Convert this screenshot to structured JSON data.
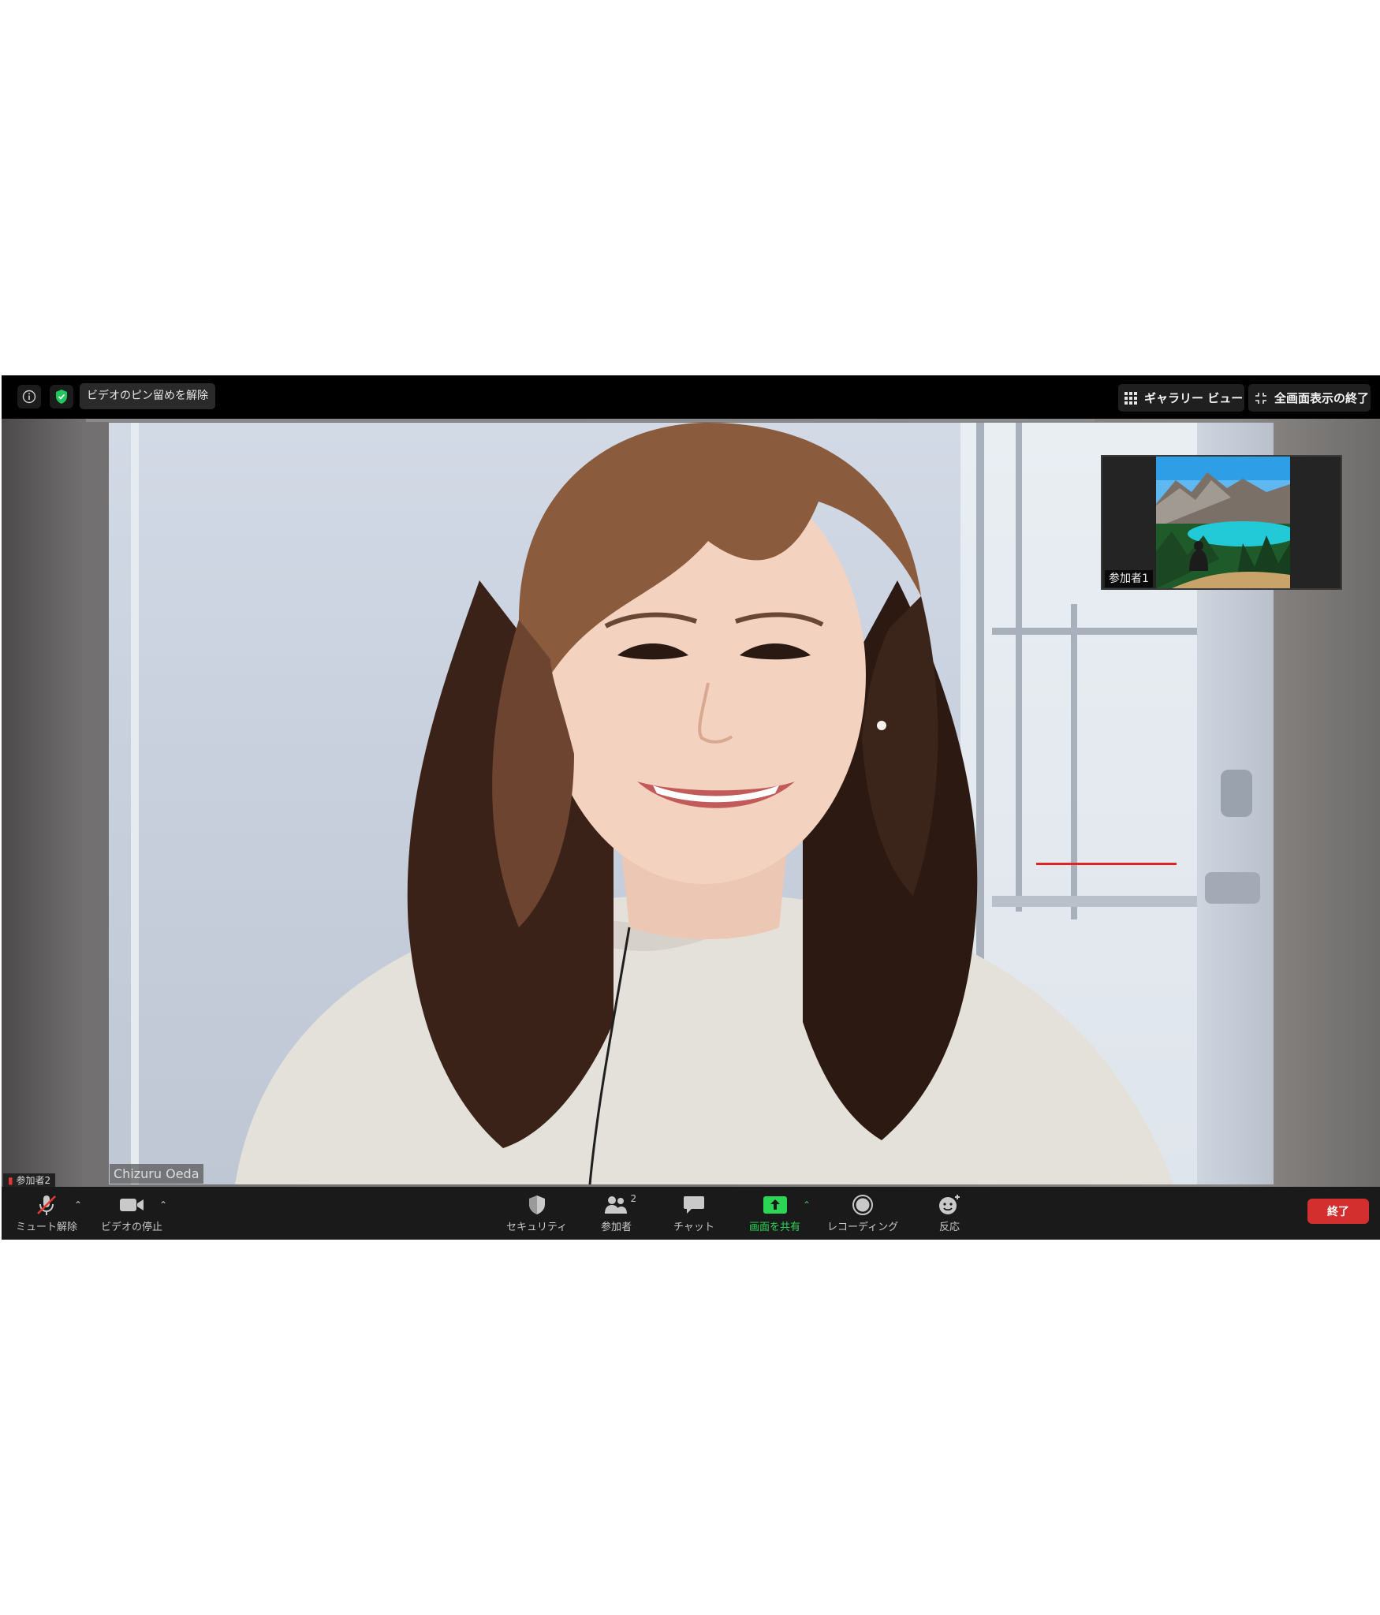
{
  "topbar": {
    "unpin_label": "ビデオのピン留めを解除",
    "gallery_label": "ギャラリー ビュー",
    "exit_fullscreen_label": "全画面表示の終了"
  },
  "main_video": {
    "name": "Chizuru Oeda"
  },
  "thumbnail": {
    "name": "参加者1"
  },
  "participant2": {
    "name": "参加者2"
  },
  "toolbar": {
    "mute_label": "ミュート解除",
    "video_label": "ビデオの停止",
    "security_label": "セキュリティ",
    "participants_label": "参加者",
    "participants_count": "2",
    "chat_label": "チャット",
    "share_label": "画面を共有",
    "record_label": "レコーディング",
    "reactions_label": "反応",
    "end_label": "終了"
  },
  "colors": {
    "share_green": "#2bd556",
    "end_red": "#d32f2f",
    "shield_green": "#22c55e"
  }
}
